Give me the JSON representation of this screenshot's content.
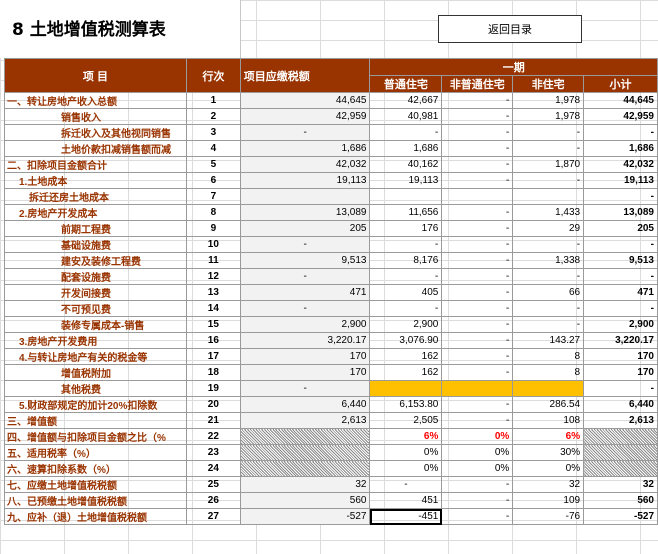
{
  "title": "8 土地增值税测算表",
  "back_button": "返回目录",
  "headers": {
    "item": "项          目",
    "row_no": "行次",
    "project_tax": "项目应缴税额",
    "period": "一期",
    "columns": [
      "普通住宅",
      "非普通住宅",
      "非住宅",
      "小计"
    ]
  },
  "rows": [
    {
      "label": "一、转让房地产收入总额",
      "no": "1",
      "proj": "44,645",
      "c1": "42,667",
      "c2": "-",
      "c3": "1,978",
      "c4": "44,645"
    },
    {
      "label": "销售收入",
      "no": "2",
      "proj": "42,959",
      "c1": "40,981",
      "c2": "-",
      "c3": "1,978",
      "c4": "42,959"
    },
    {
      "label": "拆迁收入及其他视同销售",
      "no": "3",
      "proj": "-",
      "c1": "-",
      "c2": "-",
      "c3": "-",
      "c4": "-"
    },
    {
      "label": "土地价款扣减销售额而减",
      "no": "4",
      "proj": "1,686",
      "c1": "1,686",
      "c2": "-",
      "c3": "-",
      "c4": "1,686"
    },
    {
      "label": "二、扣除项目金额合计",
      "no": "5",
      "proj": "42,032",
      "c1": "40,162",
      "c2": "-",
      "c3": "1,870",
      "c4": "42,032"
    },
    {
      "label": "1.土地成本",
      "no": "6",
      "proj": "19,113",
      "c1": "19,113",
      "c2": "-",
      "c3": "-",
      "c4": "19,113"
    },
    {
      "label": "拆迁还房土地成本",
      "no": "7",
      "proj": "",
      "c1": "",
      "c2": "",
      "c3": "",
      "c4": "-"
    },
    {
      "label": "2.房地产开发成本",
      "no": "8",
      "proj": "13,089",
      "c1": "11,656",
      "c2": "-",
      "c3": "1,433",
      "c4": "13,089"
    },
    {
      "label": "前期工程费",
      "no": "9",
      "proj": "205",
      "c1": "176",
      "c2": "-",
      "c3": "29",
      "c4": "205"
    },
    {
      "label": "基础设施费",
      "no": "10",
      "proj": "-",
      "c1": "-",
      "c2": "-",
      "c3": "-",
      "c4": "-"
    },
    {
      "label": "建安及装修工程费",
      "no": "11",
      "proj": "9,513",
      "c1": "8,176",
      "c2": "-",
      "c3": "1,338",
      "c4": "9,513"
    },
    {
      "label": "配套设施费",
      "no": "12",
      "proj": "-",
      "c1": "-",
      "c2": "-",
      "c3": "-",
      "c4": "-"
    },
    {
      "label": "开发间接费",
      "no": "13",
      "proj": "471",
      "c1": "405",
      "c2": "-",
      "c3": "66",
      "c4": "471"
    },
    {
      "label": "不可预见费",
      "no": "14",
      "proj": "-",
      "c1": "-",
      "c2": "-",
      "c3": "-",
      "c4": "-"
    },
    {
      "label": "装修专属成本-销售",
      "no": "15",
      "proj": "2,900",
      "c1": "2,900",
      "c2": "-",
      "c3": "-",
      "c4": "2,900"
    },
    {
      "label": "3.房地产开发费用",
      "no": "16",
      "proj": "3,220.17",
      "c1": "3,076.90",
      "c2": "-",
      "c3": "143.27",
      "c4": "3,220.17"
    },
    {
      "label": "4.与转让房地产有关的税金等",
      "no": "17",
      "proj": "170",
      "c1": "162",
      "c2": "-",
      "c3": "8",
      "c4": "170"
    },
    {
      "label": "增值税附加",
      "no": "18",
      "proj": "170",
      "c1": "162",
      "c2": "-",
      "c3": "8",
      "c4": "170"
    },
    {
      "label": "其他税费",
      "no": "19",
      "proj": "-",
      "c1": "",
      "c2": "",
      "c3": "",
      "c4": "-"
    },
    {
      "label": "5.财政部规定的加计20%扣除数",
      "no": "20",
      "proj": "6,440",
      "c1": "6,153.80",
      "c2": "-",
      "c3": "286.54",
      "c4": "6,440"
    },
    {
      "label": "三、增值额",
      "no": "21",
      "proj": "2,613",
      "c1": "2,505",
      "c2": "-",
      "c3": "108",
      "c4": "2,613"
    },
    {
      "label": "四、增值额与扣除项目金额之比（%",
      "no": "22",
      "proj": "",
      "c1": "6%",
      "c2": "0%",
      "c3": "6%",
      "c4": ""
    },
    {
      "label": "五、适用税率（%）",
      "no": "23",
      "proj": "",
      "c1": "0%",
      "c2": "0%",
      "c3": "30%",
      "c4": ""
    },
    {
      "label": "六、速算扣除系数（%）",
      "no": "24",
      "proj": "",
      "c1": "0%",
      "c2": "0%",
      "c3": "0%",
      "c4": ""
    },
    {
      "label": "七、应缴土地增值税税额",
      "no": "25",
      "proj": "32",
      "c1": "-",
      "c2": "-",
      "c3": "32",
      "c4": "32"
    },
    {
      "label": "八、已预缴土地增值税税额",
      "no": "26",
      "proj": "560",
      "c1": "451",
      "c2": "-",
      "c3": "109",
      "c4": "560"
    },
    {
      "label": "九、应补（退）土地增值税税额",
      "no": "27",
      "proj": "-527",
      "c1": "-451",
      "c2": "-",
      "c3": "-76",
      "c4": "-527"
    }
  ]
}
